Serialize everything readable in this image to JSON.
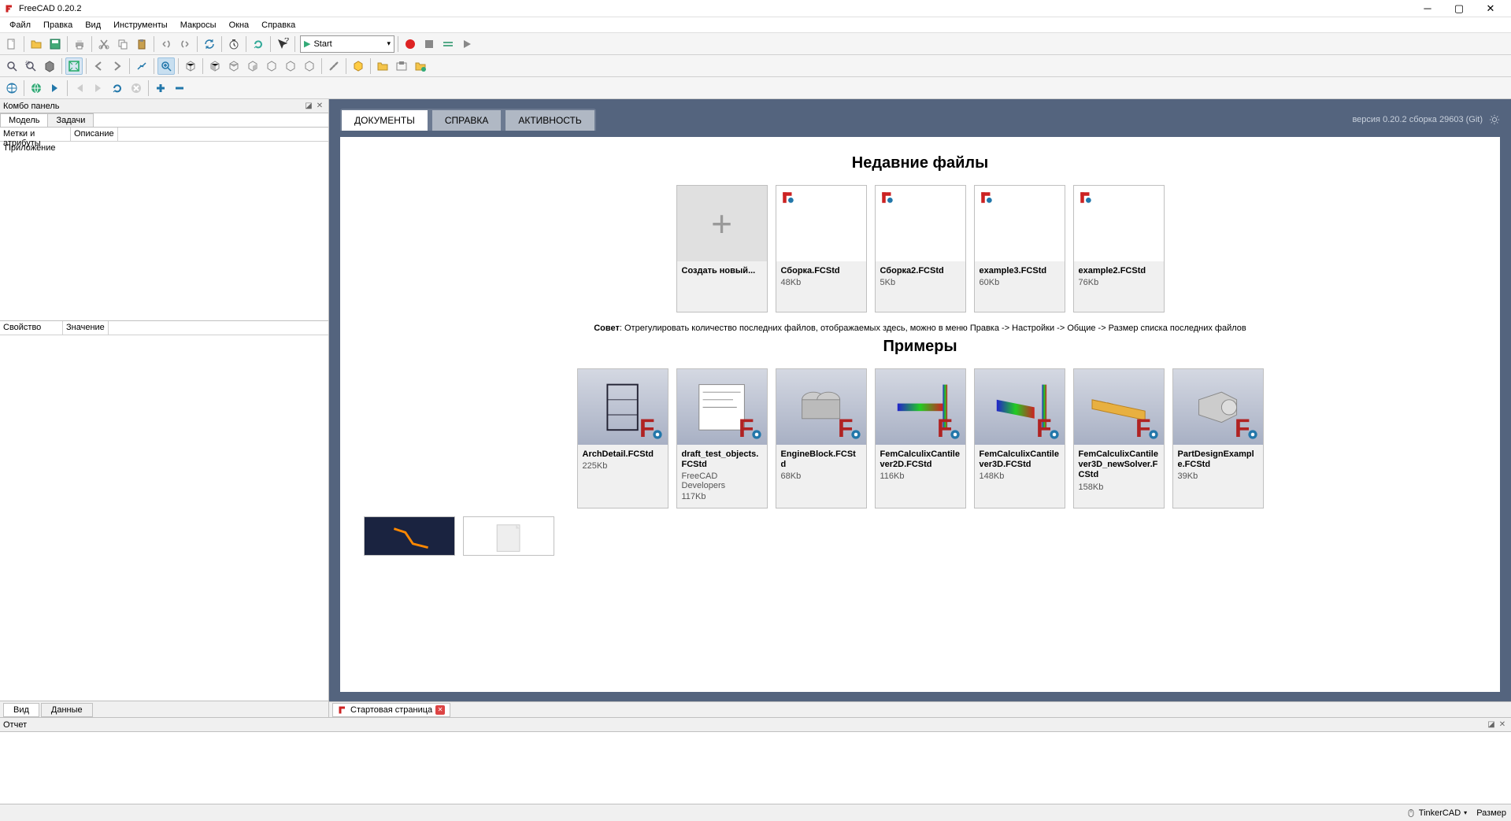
{
  "window": {
    "title": "FreeCAD 0.20.2"
  },
  "menubar": [
    "Файл",
    "Правка",
    "Вид",
    "Инструменты",
    "Макросы",
    "Окна",
    "Справка"
  ],
  "workbench_selector": "Start",
  "combo_panel": {
    "title": "Комбо панель",
    "tabs": [
      "Модель",
      "Задачи"
    ],
    "tree_cols": [
      "Метки и атрибуты",
      "Описание"
    ],
    "tree_rows": [
      "Приложение"
    ],
    "prop_cols": [
      "Свойство",
      "Значение"
    ],
    "bottom_tabs": [
      "Вид",
      "Данные"
    ]
  },
  "doc_tab": "Стартовая страница",
  "start_page": {
    "tabs": [
      "ДОКУМЕНТЫ",
      "СПРАВКА",
      "АКТИВНОСТЬ"
    ],
    "version": "версия 0.20.2 сборка 29603 (Git)",
    "recent_title": "Недавние файлы",
    "new_card": "Создать новый...",
    "recent": [
      {
        "name": "Сборка.FCStd",
        "size": "48Kb"
      },
      {
        "name": "Сборка2.FCStd",
        "size": "5Kb"
      },
      {
        "name": "example3.FCStd",
        "size": "60Kb"
      },
      {
        "name": "example2.FCStd",
        "size": "76Kb"
      }
    ],
    "tip_label": "Совет",
    "tip_text": ": Отрегулировать количество последних файлов, отображаемых здесь, можно в меню Правка -> Настройки -> Общие -> Размер списка последних файлов",
    "examples_title": "Примеры",
    "examples": [
      {
        "name": "ArchDetail.FCStd",
        "sub": "225Kb"
      },
      {
        "name": "draft_test_objects.FCStd",
        "sub": "FreeCAD Developers",
        "sub2": "117Kb"
      },
      {
        "name": "EngineBlock.FCStd",
        "sub": "68Kb"
      },
      {
        "name": "FemCalculixCantilever2D.FCStd",
        "sub": "116Kb"
      },
      {
        "name": "FemCalculixCantilever3D.FCStd",
        "sub": "148Kb"
      },
      {
        "name": "FemCalculixCantilever3D_newSolver.FCStd",
        "sub": "158Kb"
      },
      {
        "name": "PartDesignExample.FCStd",
        "sub": "39Kb"
      }
    ]
  },
  "report": {
    "title": "Отчет"
  },
  "statusbar": {
    "workbench": "TinkerCAD",
    "dim": "Размер"
  }
}
